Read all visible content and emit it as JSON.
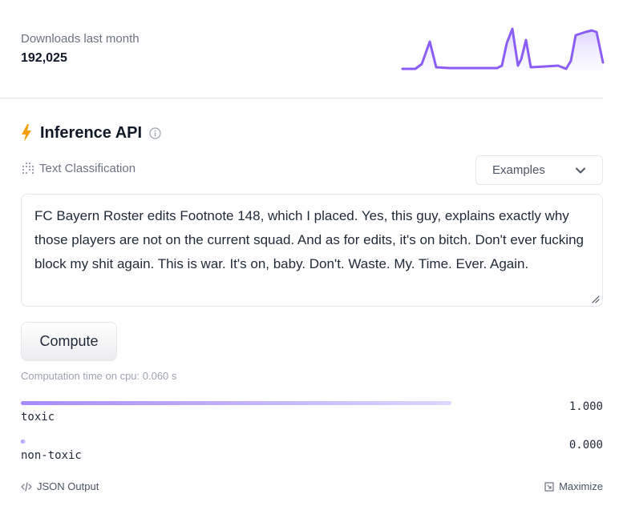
{
  "downloads": {
    "label": "Downloads last month",
    "value": "192,025"
  },
  "inference": {
    "title": "Inference API",
    "task": "Text Classification",
    "examples_label": "Examples",
    "input_text": "FC Bayern Roster edits Footnote 148, which I placed. Yes, this guy, explains exactly why those players are not on the current squad. And as for edits, it's on bitch. Don't ever fucking block my shit again.  This is war. It's on, baby. Don't. Waste. My. Time. Ever. Again.",
    "compute_label": "Compute",
    "computation_time": "Computation time on cpu: 0.060 s",
    "results": [
      {
        "label": "toxic",
        "score_text": "1.000",
        "score": 1.0
      },
      {
        "label": "non-toxic",
        "score_text": "0.000",
        "score": 0.0
      }
    ]
  },
  "footer": {
    "json_output": "JSON Output",
    "maximize": "Maximize"
  },
  "colors": {
    "accent": "#8b5cf6",
    "bolt": "#f59e0b",
    "bar_start": "#a78bfa",
    "bar_end": "#ddd6fe"
  },
  "icons": [
    "sparkline-chart",
    "bolt-icon",
    "info-icon",
    "text-classification-icon",
    "chevron-down-icon",
    "resize-handle-icon",
    "code-icon",
    "maximize-icon"
  ]
}
